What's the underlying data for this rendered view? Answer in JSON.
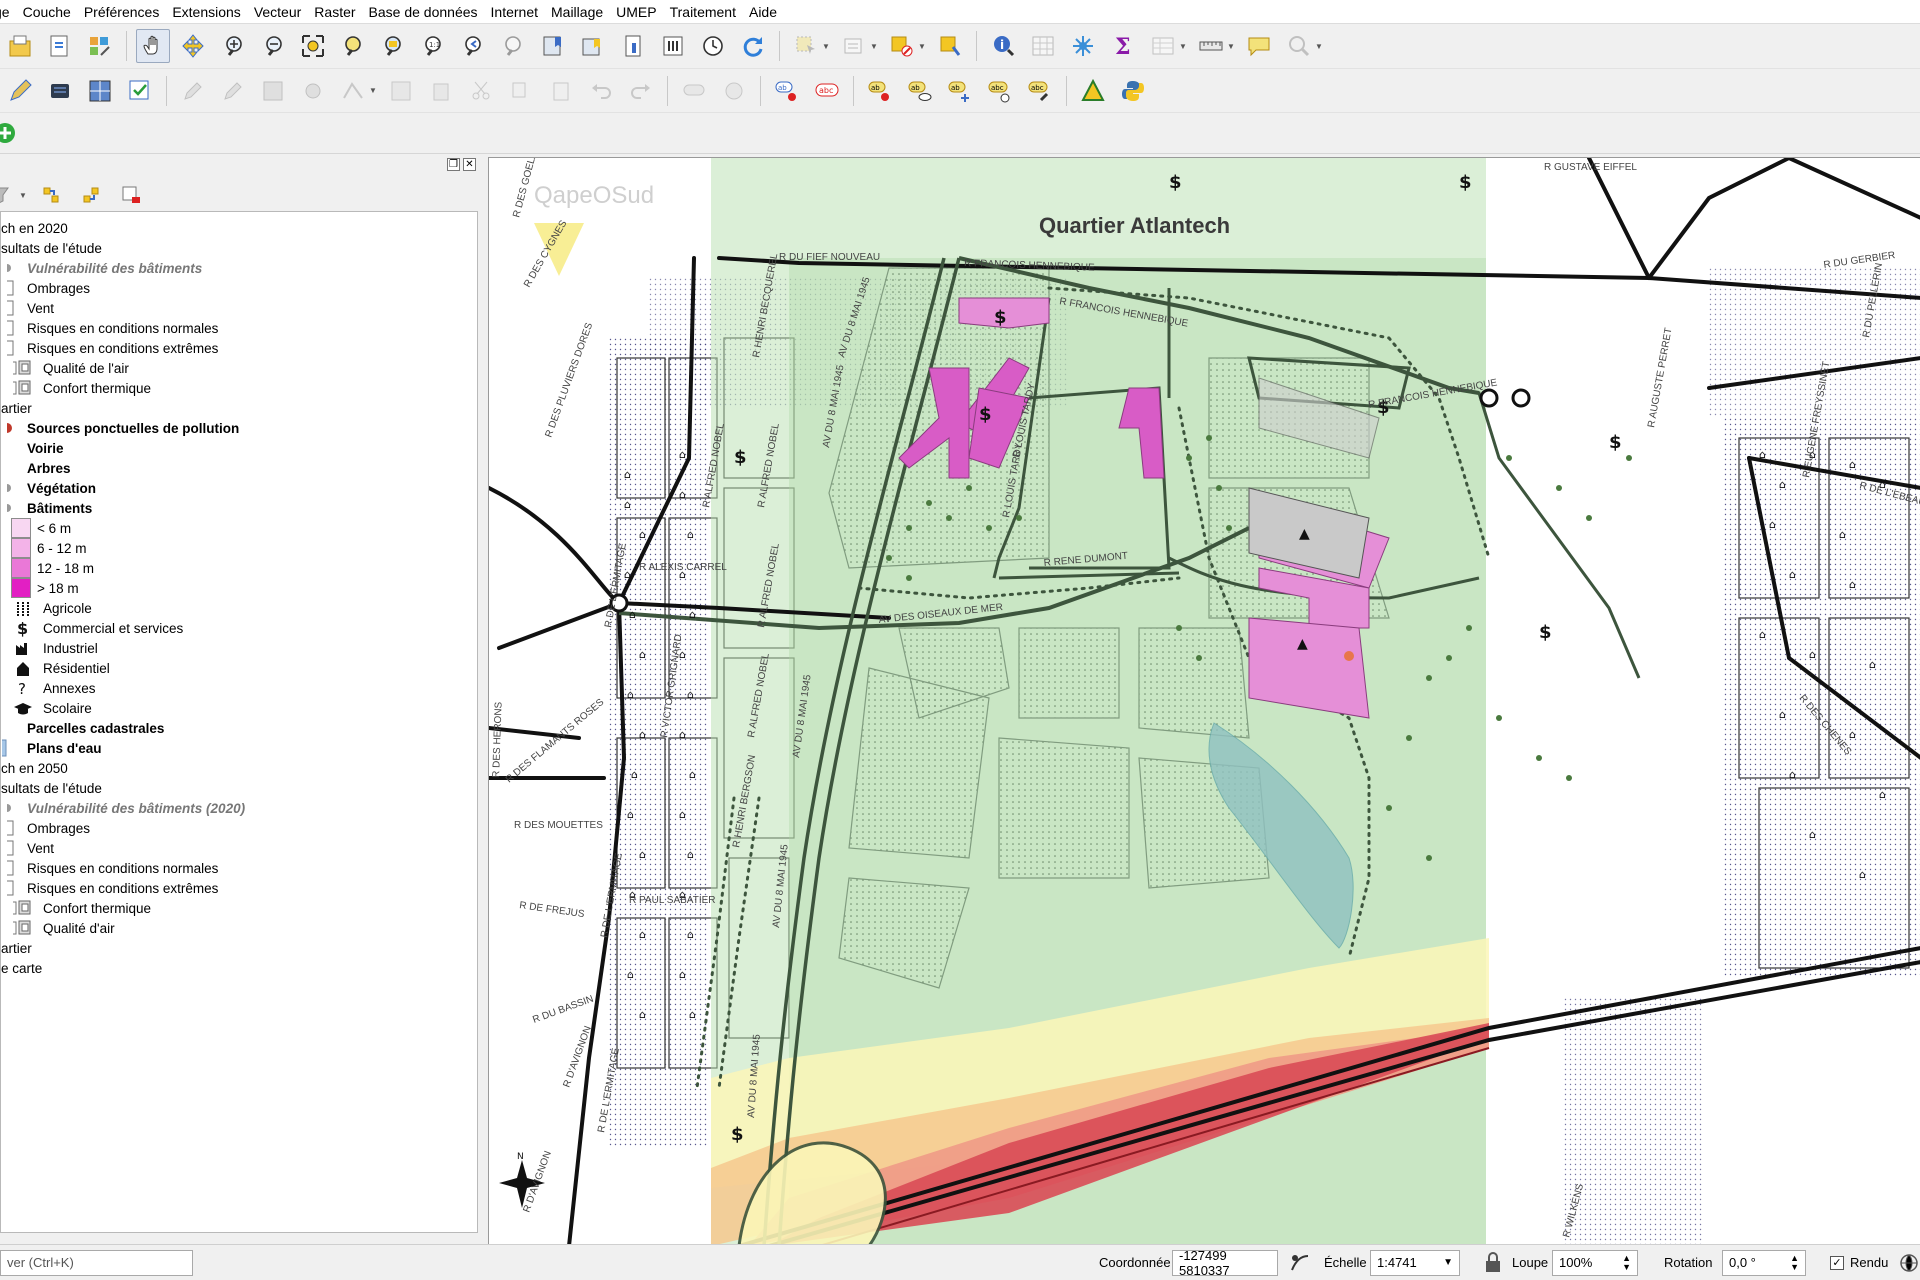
{
  "menu": [
    "ge",
    "Couche",
    "Préférences",
    "Extensions",
    "Vecteur",
    "Raster",
    "Base de données",
    "Internet",
    "Maillage",
    "UMEP",
    "Traitement",
    "Aide"
  ],
  "layer_tree": {
    "g2020": "ch en 2020",
    "res2020": "sultats de l'étude",
    "vuln2020": "Vulnérabilité des bâtiments",
    "ombrages": "Ombrages",
    "vent": "Vent",
    "risques_norm": "Risques en conditions normales",
    "risques_ext": "Risques en conditions extrêmes",
    "qualite_air": "Qualité de l'air",
    "confort": "Confort thermique",
    "quartier": "artier",
    "sources": "Sources ponctuelles de pollution",
    "voirie": "Voirie",
    "arbres": "Arbres",
    "vegetation": "Végétation",
    "batiments": "Bâtiments",
    "legend_h": [
      "< 6 m",
      "6 - 12 m",
      "12 - 18 m",
      "> 18 m"
    ],
    "legend_h_colors": [
      "#f8d7f2",
      "#f3b3e8",
      "#ea78d7",
      "#e21fc3"
    ],
    "agricole": "Agricole",
    "commercial": "Commercial et services",
    "industriel": "Industriel",
    "residentiel": "Résidentiel",
    "annexes": "Annexes",
    "scolaire": "Scolaire",
    "parcelles": "Parcelles cadastrales",
    "plans_eau": "Plans d'eau",
    "g2050": "ch en 2050",
    "res2050": "sultats de l'étude",
    "vuln2050": "Vulnérabilité des bâtiments (2020)",
    "ombrages2": "Ombrages",
    "vent2": "Vent",
    "risques_norm2": "Risques en conditions normales",
    "risques_ext2": "Risques en conditions extrêmes",
    "confort2": "Confort thermique",
    "qualite_air2": "Qualité d'air",
    "quartier2": "artier",
    "carte": "e carte"
  },
  "map": {
    "title": "Quartier Atlantech",
    "logo": "QapeOSud",
    "north": "N",
    "streets": {
      "francois1": "R FRANCOIS HENNEBIQUE",
      "francois2": "R FRANCOIS HENNEBIQUE",
      "francois3": "R FRANCOIS HENNEBIQUE",
      "fief": "R DU FIEF NOUVEAU",
      "av8mai1": "AV DU 8 MAI 1945",
      "av8mai2": "AV DU 8 MAI 1945",
      "av8mai3": "AV DU 8 MAI 1945",
      "av8mai4": "AV DU 8 MAI 1945",
      "av8mai5": "AV DU 8 MAI 1945",
      "oiseaux": "AV DES OISEAUX DE MER",
      "rene": "R RENE DUMONT",
      "tardy1": "R LOUIS TARDY",
      "tardy2": "R LOUIS TARDY",
      "pluviers": "R DES PLUVIERS DORES",
      "ermitage1": "R DE L'ERMITAGE",
      "ermitage2": "R DE L'ERMITAGE",
      "ermitage3": "R DE L'ERMITAGE",
      "flamants": "R DES FLAMANTS ROSES",
      "mouettes": "R DES MOUETTES",
      "frejus": "R DE FREJUS",
      "sabatier": "R PAUL SABATIER",
      "bassin": "R DU BASSIN",
      "avignon1": "R D'AVIGNON",
      "avignon2": "R D'AVIGNON",
      "carrel": "R ALEXIS CARREL",
      "grignard": "R VICTOR GRIGNARD",
      "nobel1": "R ALFRED NOBEL",
      "nobel2": "R ALFRED NOBEL",
      "nobel3": "R ALFRED NOBEL",
      "nobel4": "R ALFRED NOBEL",
      "bergson": "R HENRI BERGSON",
      "becquerel": "R HENRI BECQUEREL",
      "eiffel": "R GUSTAVE EIFFEL",
      "freyssinet": "R EUGENE FREYSSINET",
      "perret": "R AUGUSTE PERRET",
      "goelands": "R DES GOELANDS",
      "cygnes": "R DES CYGNES",
      "herons": "R DES HERONS",
      "gerbier": "R DU GERBIER",
      "pellerin": "R DU PELLERIN",
      "chenes": "R DES CHENES",
      "wilkens": "R WILKENS",
      "lebeaulieu": "R DE L'EBEAULIEU"
    }
  },
  "status": {
    "search_placeholder": "ver (Ctrl+K)",
    "coord_label": "Coordonnée",
    "coord_value": "-127499 5810337",
    "scale_label": "Échelle",
    "scale_value": "1:4741",
    "zoom_label": "Loupe",
    "zoom_value": "100%",
    "rotation_label": "Rotation",
    "rotation_value": "0,0 °",
    "render_label": "Rendu"
  }
}
